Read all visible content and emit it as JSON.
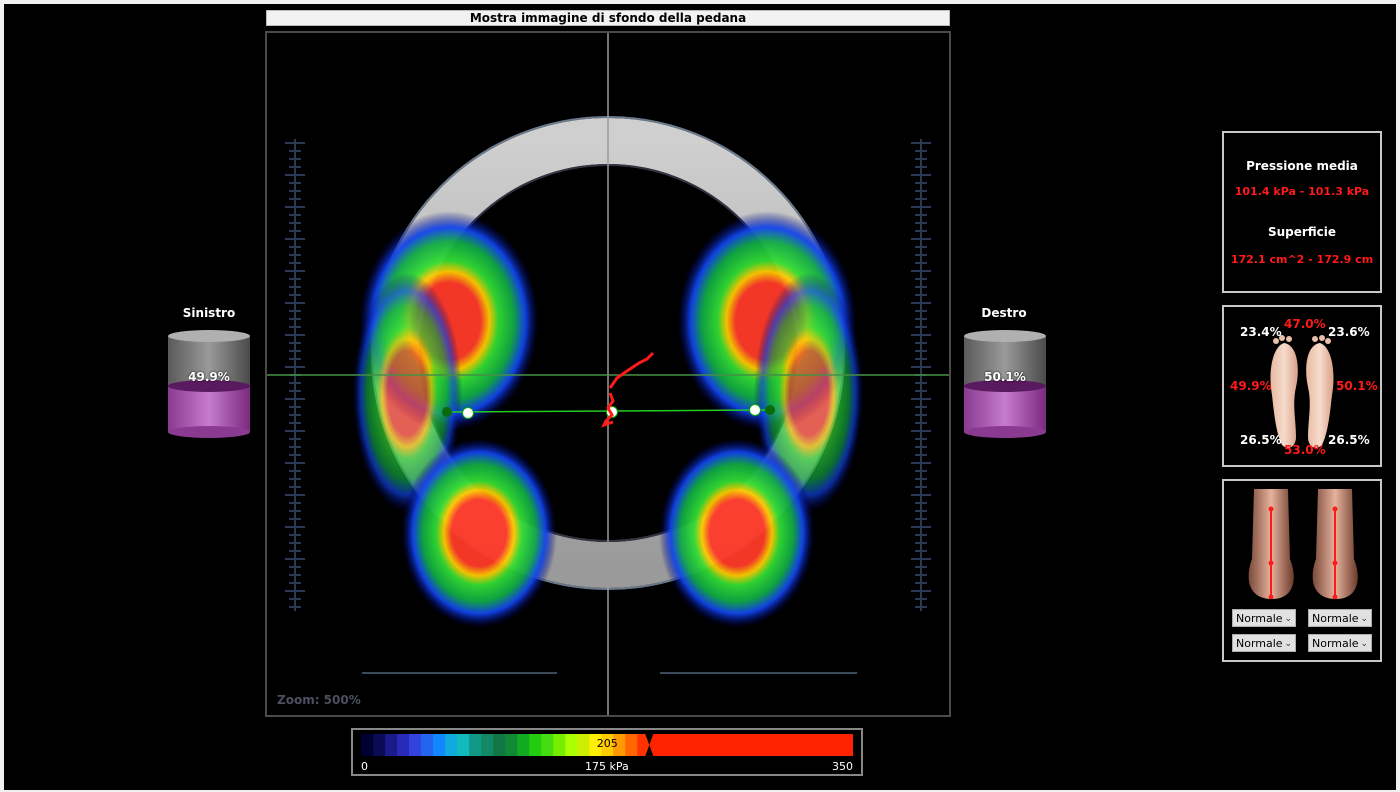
{
  "header": {
    "title": "Mostra immagine di sfondo della pedana"
  },
  "plate": {
    "zoom_label": "Zoom: 500%"
  },
  "left_side": {
    "label": "Sinistro",
    "load_text": "49.9%",
    "load_fraction": 0.499
  },
  "right_side": {
    "label": "Destro",
    "load_text": "50.1%",
    "load_fraction": 0.501
  },
  "stats": {
    "pressure_title": "Pressione media",
    "pressure_value": "101.4 kPa - 101.3 kPa",
    "surface_title": "Superficie",
    "surface_value": "172.1 cm^2 - 172.9 cm"
  },
  "foot_distribution": {
    "left_front": "23.4%",
    "right_front": "23.6%",
    "front_total": "47.0%",
    "left_total": "49.9%",
    "right_total": "50.1%",
    "left_rear": "26.5%",
    "right_rear": "26.5%",
    "rear_total": "53.0%"
  },
  "posture": {
    "selects": [
      {
        "value": "Normale"
      },
      {
        "value": "Normale"
      },
      {
        "value": "Normale"
      },
      {
        "value": "Normale"
      }
    ]
  },
  "scale": {
    "min_label": "0",
    "mid_label": "175 kPa",
    "max_label": "350",
    "marker_value": "205",
    "marker_fraction": 0.586
  },
  "colors": {
    "background": "#000000",
    "accent_red": "#ff1a1a",
    "cylinder_fill": "#b35cb8",
    "cop_line": "#22aa22"
  },
  "icons": [
    "feet-sole-icon",
    "heel-leg-icon",
    "chevron-down-icon"
  ]
}
